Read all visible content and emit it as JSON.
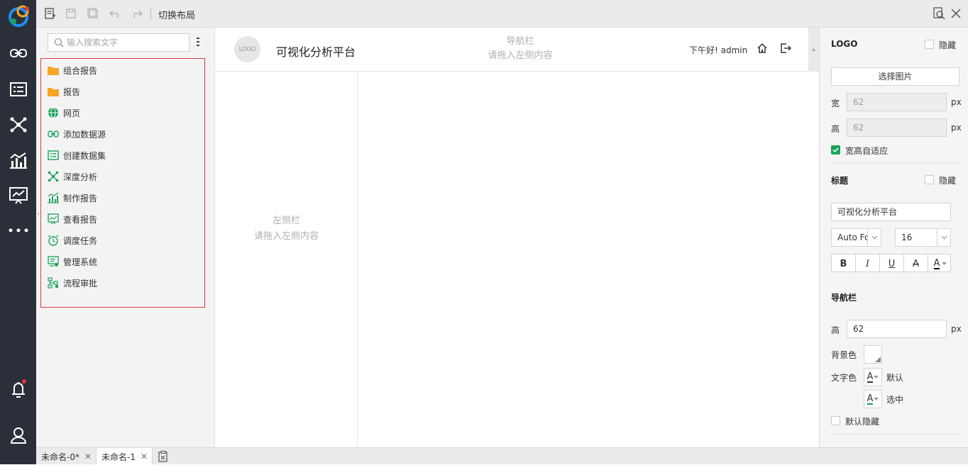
{
  "toolbar": {
    "switch_layout_label": "切换布局"
  },
  "resource_panel": {
    "search_placeholder": "输入搜索文字",
    "items": [
      {
        "label": "组合报告",
        "icon": "folder-icon"
      },
      {
        "label": "报告",
        "icon": "folder-icon"
      },
      {
        "label": "网页",
        "icon": "globe-icon"
      },
      {
        "label": "添加数据源",
        "icon": "link-icon"
      },
      {
        "label": "创建数据集",
        "icon": "dataset-icon"
      },
      {
        "label": "深度分析",
        "icon": "analysis-icon"
      },
      {
        "label": "制作报告",
        "icon": "chart-icon"
      },
      {
        "label": "查看报告",
        "icon": "view-report-icon"
      },
      {
        "label": "调度任务",
        "icon": "alarm-icon"
      },
      {
        "label": "管理系统",
        "icon": "admin-icon"
      },
      {
        "label": "流程审批",
        "icon": "workflow-icon"
      }
    ]
  },
  "canvas": {
    "logo_text": "LOGO",
    "title": "可视化分析平台",
    "nav_hint_title": "导航栏",
    "nav_hint_sub": "请拖入左侧内容",
    "greeting": "下午好! admin",
    "left_hint_title": "左侧栏",
    "left_hint_sub": "请拖入左侧内容"
  },
  "properties": {
    "logo_section": "LOGO",
    "hide_label": "隐藏",
    "select_image": "选择图片",
    "width_label": "宽",
    "width_value": "62",
    "height_label": "高",
    "height_value": "62",
    "unit": "px",
    "auto_fit_label": "宽高自适应",
    "title_section": "标题",
    "title_hide_label": "隐藏",
    "title_value": "可视化分析平台",
    "font_family": "Auto Font",
    "font_size": "16",
    "format_bold": "B",
    "format_italic": "I",
    "format_underline": "U",
    "format_strike": "A",
    "font_color_glyph": "A",
    "nav_section": "导航栏",
    "nav_height_label": "高",
    "nav_height_value": "62",
    "nav_unit": "px",
    "bg_color_label": "背景色",
    "text_color_label": "文字色",
    "text_color_glyph": "A",
    "default_label": "默认",
    "selected_glyph": "A",
    "selected_label": "选中",
    "default_hide_label": "默认隐藏",
    "colors": {
      "accent_green": "#1aa35b",
      "folder_orange": "#f5a623",
      "highlight_red": "#e0383b"
    }
  },
  "tabs": [
    {
      "label": "未命名-0*"
    },
    {
      "label": "未命名-1"
    }
  ]
}
